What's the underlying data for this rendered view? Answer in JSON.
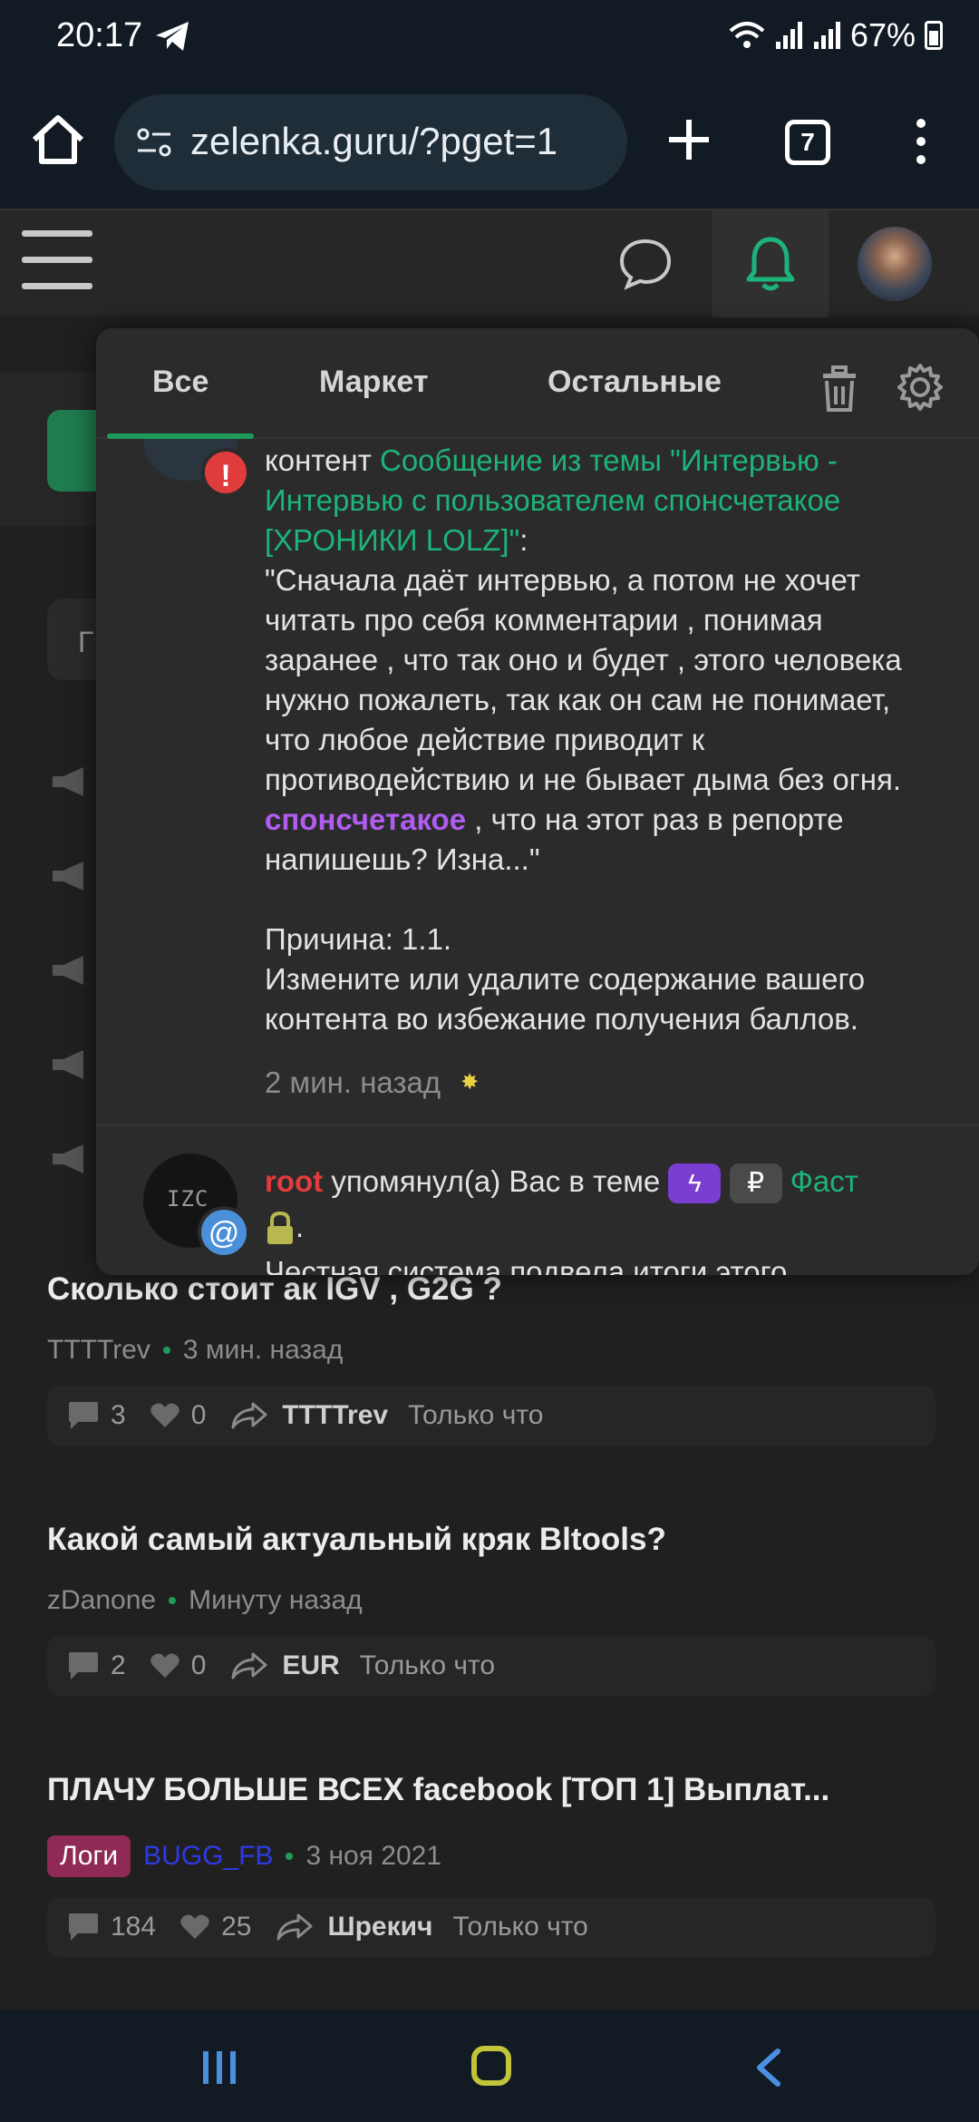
{
  "status": {
    "time": "20:17",
    "battery": "67%"
  },
  "browser": {
    "url": "zelenka.guru/?pget=1",
    "tab_count": "7"
  },
  "background": {
    "g_letter": "Г"
  },
  "popup": {
    "tabs": [
      "Все",
      "Маркет",
      "Остальные"
    ],
    "n1": {
      "lead": "контент ",
      "link": "Сообщение из темы \"Интервью - Интервью с пользователем спонсчетакое [ХРОНИКИ LOLZ]\"",
      "colon": ":",
      "quote_a": "\"Сначала даёт интервью, а потом не хочет читать про себя комментарии , понимая заранее , что так оно и будет , этого человека нужно пожалеть, так как он сам не понимает, что любое действие приводит к противодействию и не бывает дыма без огня. ",
      "mention": "спонсчетакое",
      "quote_b": " , что на этот раз в репорте напишешь? Изна...\"",
      "reason": "Причина: 1.1.",
      "reason_text": "Измените или удалите содержание вашего контента во избежание получения баллов.",
      "time": "2 мин. назад",
      "badge": "!"
    },
    "n2": {
      "user": "root",
      "text": " упомянул(а) Вас в теме ",
      "ruble": "₽",
      "prefix": "Фаст",
      "period": ".",
      "preview": "Честная система подвела итоги этого",
      "badge": "@",
      "avatar_text": "IZC"
    }
  },
  "threads": [
    {
      "title": "Сколько стоит ак IGV , G2G ?",
      "author": "TTTTrev",
      "time": "3 мин. назад",
      "replies": "3",
      "likes": "0",
      "last_user": "TTTTrev",
      "last_time": "Только что"
    },
    {
      "title": "Какой самый актуальный кряк Bltools?",
      "author": "zDanone",
      "time": "Минуту назад",
      "replies": "2",
      "likes": "0",
      "last_user": "EUR",
      "last_time": "Только что"
    },
    {
      "title": "ПЛАЧУ БОЛЬШЕ ВСЕХ facebook [ТОП 1] Выплат...",
      "prefix": "Логи",
      "author": "BUGG_FB",
      "time": "3 ноя 2021",
      "replies": "184",
      "likes": "25",
      "last_user": "Шрекич",
      "last_time": "Только что"
    }
  ],
  "colors": {
    "accent": "#1db37a",
    "danger": "#e23b3b",
    "mention": "#b05cf0",
    "background": "#202020"
  }
}
